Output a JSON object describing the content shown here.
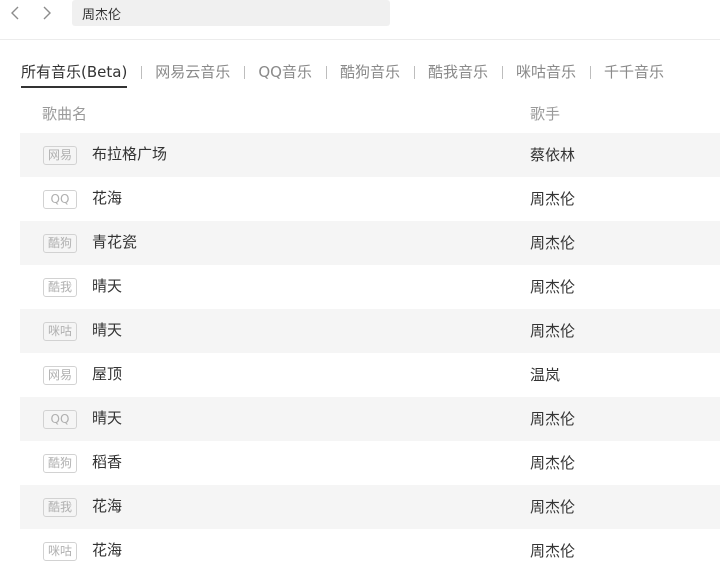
{
  "search": {
    "value": "周杰伦"
  },
  "tabs": [
    {
      "label": "所有音乐(Beta)",
      "active": true
    },
    {
      "label": "网易云音乐"
    },
    {
      "label": "QQ音乐"
    },
    {
      "label": "酷狗音乐"
    },
    {
      "label": "酷我音乐"
    },
    {
      "label": "咪咕音乐"
    },
    {
      "label": "千千音乐"
    }
  ],
  "table": {
    "headers": {
      "song": "歌曲名",
      "artist": "歌手"
    },
    "rows": [
      {
        "source": "网易",
        "song": "布拉格广场",
        "artist": "蔡依林"
      },
      {
        "source": "QQ",
        "song": "花海",
        "artist": "周杰伦"
      },
      {
        "source": "酷狗",
        "song": "青花瓷",
        "artist": "周杰伦"
      },
      {
        "source": "酷我",
        "song": "晴天",
        "artist": "周杰伦"
      },
      {
        "source": "咪咕",
        "song": "晴天",
        "artist": "周杰伦"
      },
      {
        "source": "网易",
        "song": "屋顶",
        "artist": "温岚"
      },
      {
        "source": "QQ",
        "song": "晴天",
        "artist": "周杰伦"
      },
      {
        "source": "酷狗",
        "song": "稻香",
        "artist": "周杰伦"
      },
      {
        "source": "酷我",
        "song": "花海",
        "artist": "周杰伦"
      },
      {
        "source": "咪咕",
        "song": "花海",
        "artist": "周杰伦"
      }
    ]
  }
}
